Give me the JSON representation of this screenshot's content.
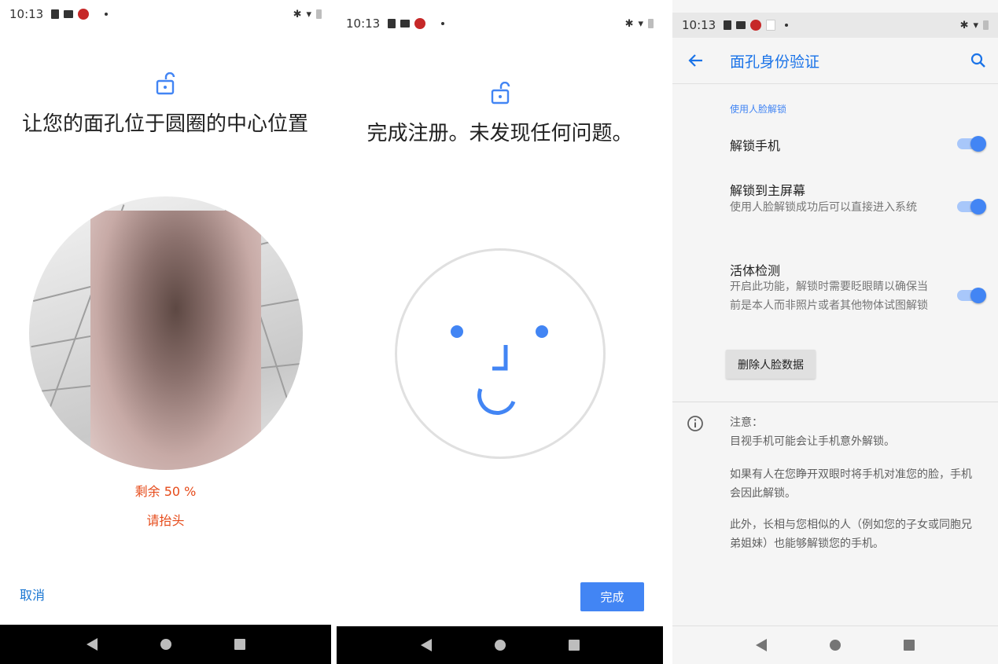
{
  "status_bar": {
    "time": "10:13"
  },
  "panel1": {
    "title": "让您的面孔位于圆圈的中心位置",
    "progress_text": "剩余 50 %",
    "hint_text": "请抬头",
    "cancel_label": "取消"
  },
  "panel2": {
    "title": "完成注册。未发现任何问题。",
    "done_label": "完成"
  },
  "panel3": {
    "app_title": "面孔身份验证",
    "section_header": "使用人脸解锁",
    "prefs": [
      {
        "title": "解锁手机",
        "summary": "",
        "enabled": true
      },
      {
        "title": "解锁到主屏幕",
        "summary": "使用人脸解锁成功后可以直接进入系统",
        "enabled": true
      },
      {
        "title": "活体检测",
        "summary": "开启此功能，解锁时需要眨眼睛以确保当前是本人而非照片或者其他物体试图解锁",
        "enabled": true
      }
    ],
    "delete_label": "删除人脸数据",
    "note": {
      "heading": "注意：",
      "line1": "目视手机可能会让手机意外解锁。",
      "para2": "如果有人在您睁开双眼时将手机对准您的脸，手机会因此解锁。",
      "para3": "此外，长相与您相似的人（例如您的子女或同胞兄弟姐妹）也能够解锁您的手机。"
    }
  },
  "colors": {
    "accent": "#4285f4",
    "warning": "#e64a19",
    "link": "#1976d2"
  },
  "icons": [
    "unlock-icon",
    "back-arrow-icon",
    "search-icon",
    "info-icon",
    "nav-back-icon",
    "nav-home-icon",
    "nav-recents-icon"
  ]
}
